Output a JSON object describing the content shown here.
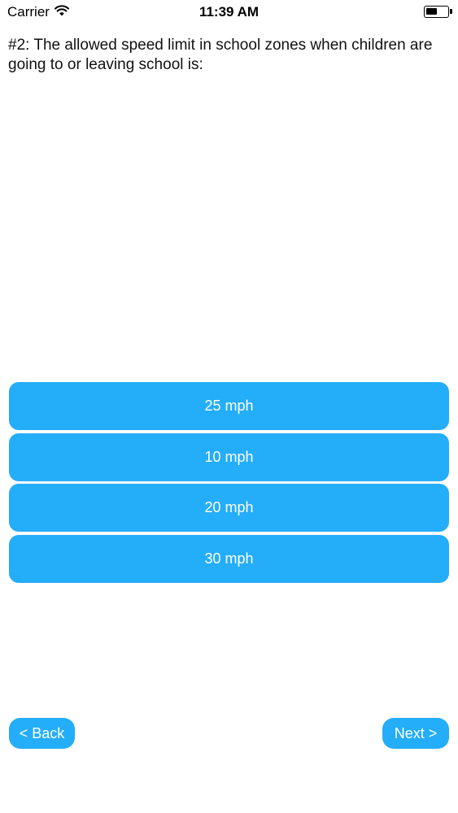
{
  "status_bar": {
    "carrier": "Carrier",
    "time": "11:39 AM",
    "icons": [
      "wifi-icon",
      "battery-icon"
    ]
  },
  "question": {
    "text": "#2: The allowed speed limit in school zones when children are going to or leaving school is:"
  },
  "answers": [
    {
      "label": "25 mph"
    },
    {
      "label": "10 mph"
    },
    {
      "label": "20 mph"
    },
    {
      "label": "30 mph"
    }
  ],
  "navigation": {
    "back_label": "< Back",
    "next_label": "Next >"
  },
  "colors": {
    "accent": "#24adf8",
    "button_text": "#ffffff",
    "background": "#ffffff"
  }
}
